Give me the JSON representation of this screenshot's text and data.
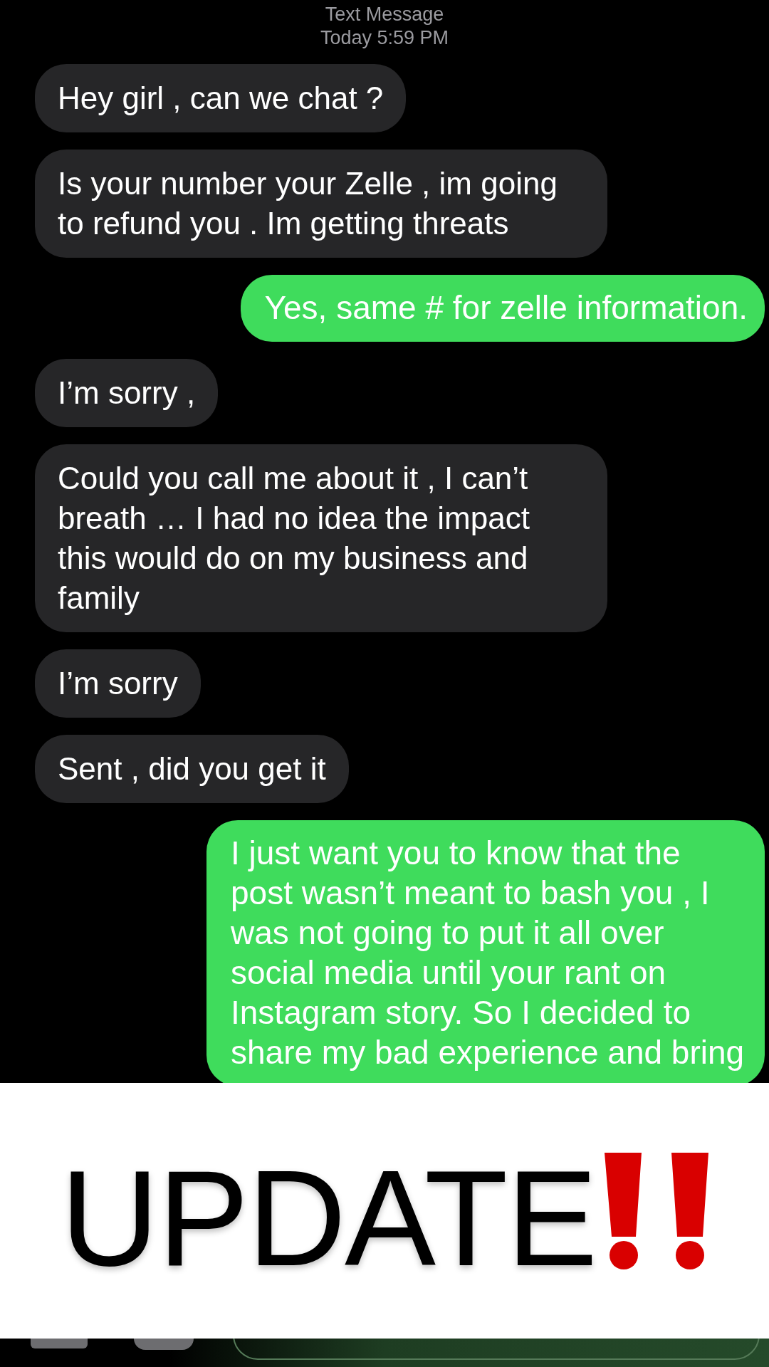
{
  "header": {
    "title": "Text Message",
    "timestamp": "Today 5:59 PM"
  },
  "messages": [
    {
      "kind": "received",
      "text": "Hey girl , can we chat ?"
    },
    {
      "kind": "received",
      "text": "Is your number your Zelle , im going to refund you . Im getting threats"
    },
    {
      "kind": "sent",
      "text": "Yes, same # for zelle information."
    },
    {
      "kind": "received",
      "text": "I’m sorry ,"
    },
    {
      "kind": "received",
      "text": "Could you call me about it , I can’t breath … I had no idea the impact this would do on my business and family"
    },
    {
      "kind": "received",
      "text": "I’m sorry"
    },
    {
      "kind": "received",
      "text": "Sent , did you get it"
    },
    {
      "kind": "sent",
      "text": "I just want you to know that the post wasn’t meant to bash you , I was not going to put it all over social media until your rant on Instagram story. So I decided to share my bad experience and bring"
    }
  ],
  "banner": {
    "text": "UPDATE"
  }
}
